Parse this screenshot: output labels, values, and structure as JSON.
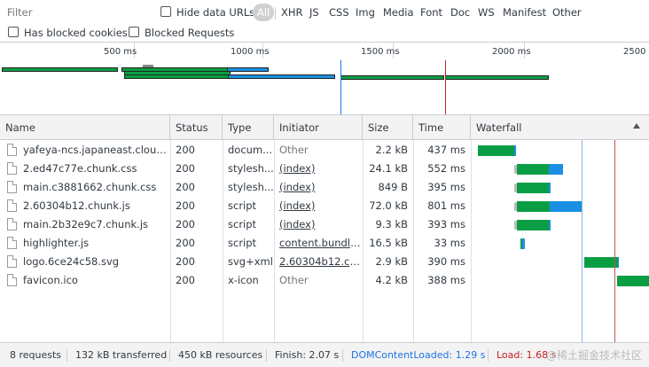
{
  "filter": {
    "placeholder": "Filter",
    "hide_data_urls": "Hide data URLs",
    "types": [
      "All",
      "XHR",
      "JS",
      "CSS",
      "Img",
      "Media",
      "Font",
      "Doc",
      "WS",
      "Manifest",
      "Other"
    ],
    "active_type": "All",
    "has_blocked_cookies": "Has blocked cookies",
    "blocked_requests": "Blocked Requests"
  },
  "overview": {
    "ticks": [
      "500 ms",
      "1000 ms",
      "1500 ms",
      "2000 ms",
      "2500"
    ]
  },
  "table": {
    "headers": {
      "name": "Name",
      "status": "Status",
      "type": "Type",
      "initiator": "Initiator",
      "size": "Size",
      "time": "Time",
      "waterfall": "Waterfall"
    },
    "rows": [
      {
        "name": "yafeya-ncs.japaneast.clouda...",
        "status": "200",
        "type": "docum...",
        "initiator": "Other",
        "size": "2.2 kB",
        "time": "437 ms"
      },
      {
        "name": "2.ed47c77e.chunk.css",
        "status": "200",
        "type": "stylesh...",
        "initiator": "(index)",
        "size": "24.1 kB",
        "time": "552 ms"
      },
      {
        "name": "main.c3881662.chunk.css",
        "status": "200",
        "type": "stylesh...",
        "initiator": "(index)",
        "size": "849 B",
        "time": "395 ms"
      },
      {
        "name": "2.60304b12.chunk.js",
        "status": "200",
        "type": "script",
        "initiator": "(index)",
        "size": "72.0 kB",
        "time": "801 ms"
      },
      {
        "name": "main.2b32e9c7.chunk.js",
        "status": "200",
        "type": "script",
        "initiator": "(index)",
        "size": "9.3 kB",
        "time": "393 ms"
      },
      {
        "name": "highlighter.js",
        "status": "200",
        "type": "script",
        "initiator": "content.bundle...",
        "size": "16.5 kB",
        "time": "33 ms"
      },
      {
        "name": "logo.6ce24c58.svg",
        "status": "200",
        "type": "svg+xml",
        "initiator": "2.60304b12.ch...",
        "size": "2.9 kB",
        "time": "390 ms"
      },
      {
        "name": "favicon.ico",
        "status": "200",
        "type": "x-icon",
        "initiator": "Other",
        "size": "4.2 kB",
        "time": "388 ms"
      }
    ]
  },
  "status_bar": {
    "requests": "8 requests",
    "transferred": "132 kB transferred",
    "resources": "450 kB resources",
    "finish": "Finish: 2.07 s",
    "dom_content_loaded": "DOMContentLoaded: 1.29 s",
    "load": "Load: 1.68 s",
    "watermark": "@稀土掘金技术社区"
  },
  "colors": {
    "waiting": "#0a9e44",
    "download": "#1a8fe3",
    "dom_line": "#1a73e8",
    "load_line": "#c5221f"
  }
}
